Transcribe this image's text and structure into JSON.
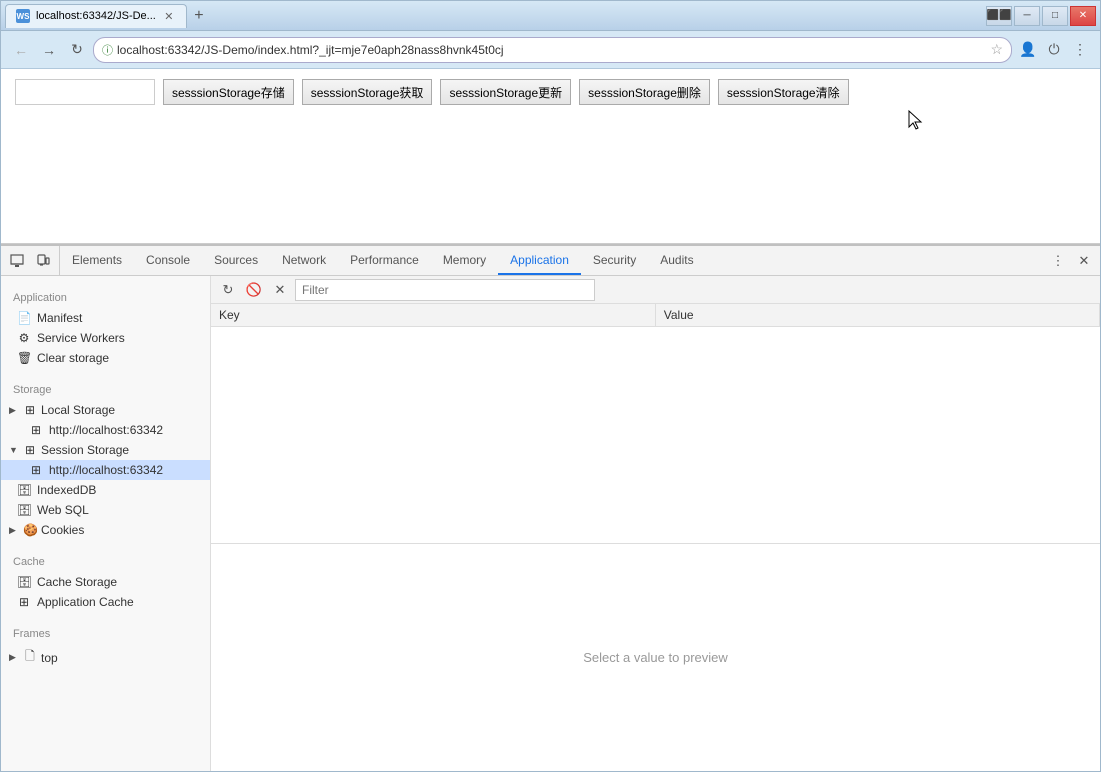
{
  "window": {
    "title": "localhost:63342/JS-De...",
    "url": "localhost:63342/JS-Demo/index.html?_ijt=mje7e0aph28nass8hvnk45t0cj"
  },
  "page": {
    "buttons": [
      "sesssionStorage存储",
      "sesssionStorage获取",
      "sesssionStorage更新",
      "sesssionStorage删除",
      "sesssionStorage清除"
    ],
    "input_placeholder": ""
  },
  "devtools": {
    "tabs": [
      "Elements",
      "Console",
      "Sources",
      "Network",
      "Performance",
      "Memory",
      "Application",
      "Security",
      "Audits"
    ],
    "active_tab": "Application"
  },
  "sidebar": {
    "application_section": "Application",
    "application_items": [
      {
        "label": "Manifest",
        "icon": "📄"
      },
      {
        "label": "Service Workers",
        "icon": "⚙"
      },
      {
        "label": "Clear storage",
        "icon": "🗑"
      }
    ],
    "storage_section": "Storage",
    "local_storage_label": "Local Storage",
    "local_storage_child": "http://localhost:63342",
    "session_storage_label": "Session Storage",
    "session_storage_child": "http://localhost:63342",
    "indexed_db_label": "IndexedDB",
    "web_sql_label": "Web SQL",
    "cookies_label": "Cookies",
    "cache_section": "Cache",
    "cache_storage_label": "Cache Storage",
    "app_cache_label": "Application Cache",
    "frames_section": "Frames",
    "frames_child": "top"
  },
  "storage": {
    "filter_placeholder": "Filter",
    "table_headers": [
      "Key",
      "Value"
    ],
    "preview_text": "Select a value to preview"
  },
  "window_controls": {
    "restore": "❐",
    "minimize": "─",
    "maximize": "□",
    "close": "✕"
  }
}
